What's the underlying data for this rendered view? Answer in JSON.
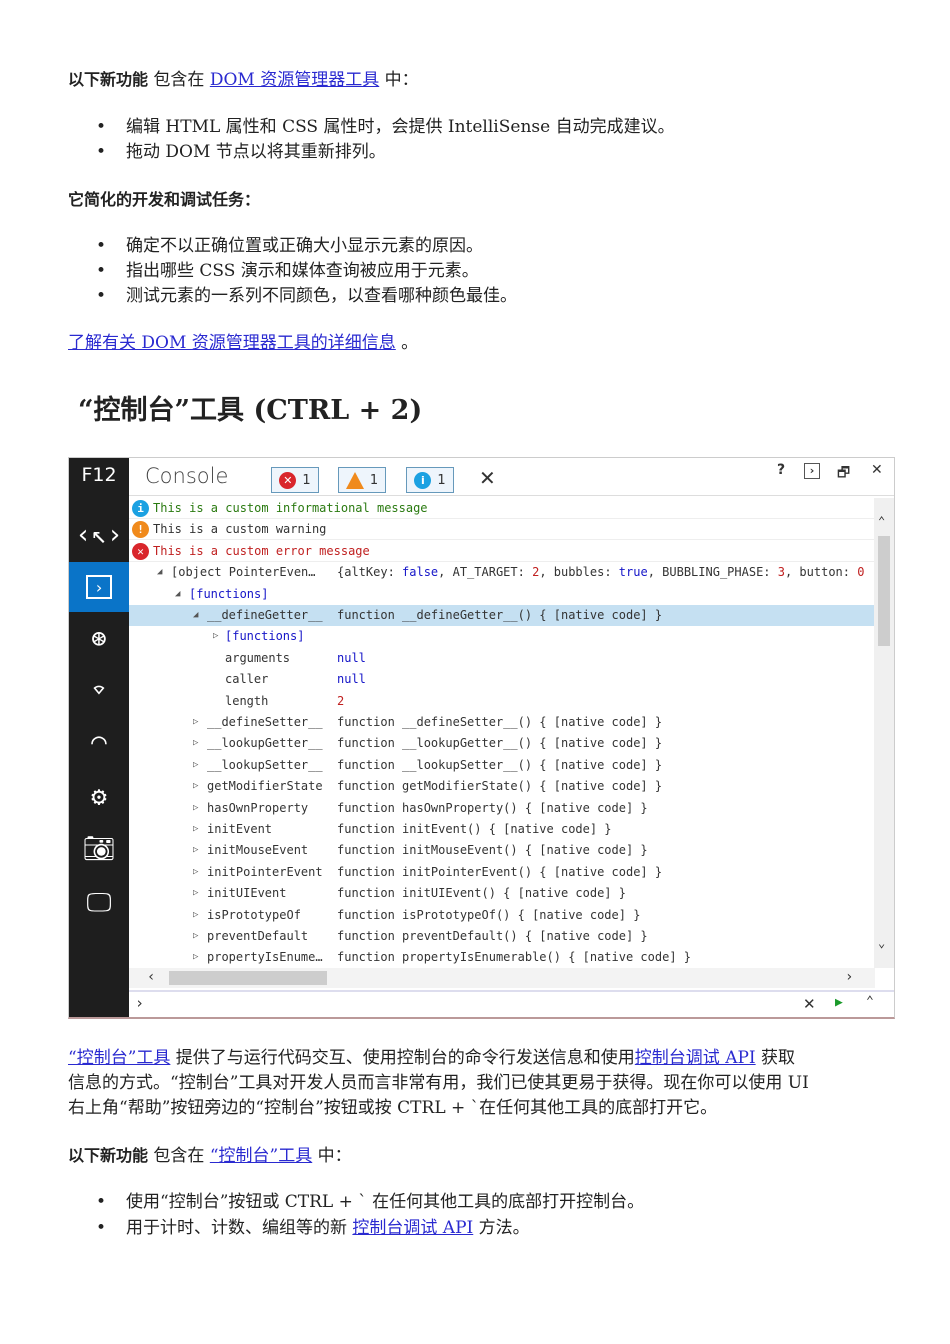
{
  "p1": {
    "bold": "以下新功能",
    "mid": " 包含在 ",
    "link": "DOM 资源管理器工具",
    "end": " 中："
  },
  "b1": [
    "编辑 HTML 属性和 CSS 属性时，会提供 IntelliSense 自动完成建议。",
    "拖动 DOM 节点以将其重新排列。"
  ],
  "h2": "它简化的开发和调试任务：",
  "b2": [
    "确定不以正确位置或正确大小显示元素的原因。",
    "指出哪些 CSS 演示和媒体查询被应用于元素。",
    "测试元素的一系列不同颜色，以查看哪种颜色最佳。"
  ],
  "learn": {
    "link": "了解有关 DOM 资源管理器工具的详细信息",
    "end": " 。"
  },
  "h1": "“控制台”工具 (CTRL + 2)",
  "devtools": {
    "f12": "F12",
    "title": "Console",
    "badges": [
      {
        "icon": "error-icon",
        "count": "1",
        "color": "#d9262c"
      },
      {
        "icon": "warning-icon",
        "count": "1",
        "color": "#f08a1c"
      },
      {
        "icon": "info-icon",
        "count": "1",
        "color": "#1ba1e2"
      }
    ],
    "clear": "✕",
    "help": "?",
    "undock": "🗗",
    "close": "✕",
    "messages": [
      {
        "type": "info",
        "text": "This is a custom informational message"
      },
      {
        "type": "warning",
        "text": "This is a custom warning"
      },
      {
        "type": "error",
        "text": "This is a custom error message"
      }
    ],
    "object": {
      "key": "[object PointerEven…",
      "value": "{altKey: false, AT_TARGET: 2, bubbles: true, BUBBLING_PHASE: 3, button: 0"
    },
    "functions": "[functions]",
    "selected": {
      "key": "__defineGetter__",
      "value": "function __defineGetter__() { [native code] }"
    },
    "children": [
      {
        "key": "arguments",
        "value": "null",
        "cls": "blue"
      },
      {
        "key": "caller",
        "value": "null",
        "cls": "blue"
      },
      {
        "key": "length",
        "value": "2",
        "cls": "red"
      }
    ],
    "props": [
      {
        "key": "__defineSetter__",
        "value": "function __defineSetter__() { [native code] }"
      },
      {
        "key": "__lookupGetter__",
        "value": "function __lookupGetter__() { [native code] }"
      },
      {
        "key": "__lookupSetter__",
        "value": "function __lookupSetter__() { [native code] }"
      },
      {
        "key": "getModifierState",
        "value": "function getModifierState() { [native code] }"
      },
      {
        "key": "hasOwnProperty",
        "value": "function hasOwnProperty() { [native code] }"
      },
      {
        "key": "initEvent",
        "value": "function initEvent() { [native code] }"
      },
      {
        "key": "initMouseEvent",
        "value": "function initMouseEvent() { [native code] }"
      },
      {
        "key": "initPointerEvent",
        "value": "function initPointerEvent() { [native code] }"
      },
      {
        "key": "initUIEvent",
        "value": "function initUIEvent() { [native code] }"
      },
      {
        "key": "isPrototypeOf",
        "value": "function isPrototypeOf() { [native code] }"
      },
      {
        "key": "preventDefault",
        "value": "function preventDefault() { [native code] }"
      },
      {
        "key": "propertyIsEnume…",
        "value": "function propertyIsEnumerable() { [native code] }"
      }
    ],
    "prompt": "›"
  },
  "p2": {
    "link1": "“控制台”工具",
    "t1": "提供了与运行代码交互、使用控制台的命令行发送信息和使用",
    "link2": "控制台调试 API",
    "t2": " 获取",
    "line2": "信息的方式。“控制台”工具对开发人员而言非常有用，我们已使其更易于获得。现在你可以使用 UI",
    "line3": "右上角“帮助”按钮旁边的“控制台”按钮或按 CTRL + `在任何其他工具的底部打开它。"
  },
  "p3": {
    "bold": "以下新功能",
    "mid": " 包含在 ",
    "link": "“控制台”工具",
    "end": " 中："
  },
  "b3": {
    "item1": "使用“控制台”按钮或 CTRL + ` 在任何其他工具的底部打开控制台。",
    "item2pre": "用于计时、计数、编组等的新 ",
    "item2link": "控制台调试 API",
    "item2post": " 方法。"
  }
}
